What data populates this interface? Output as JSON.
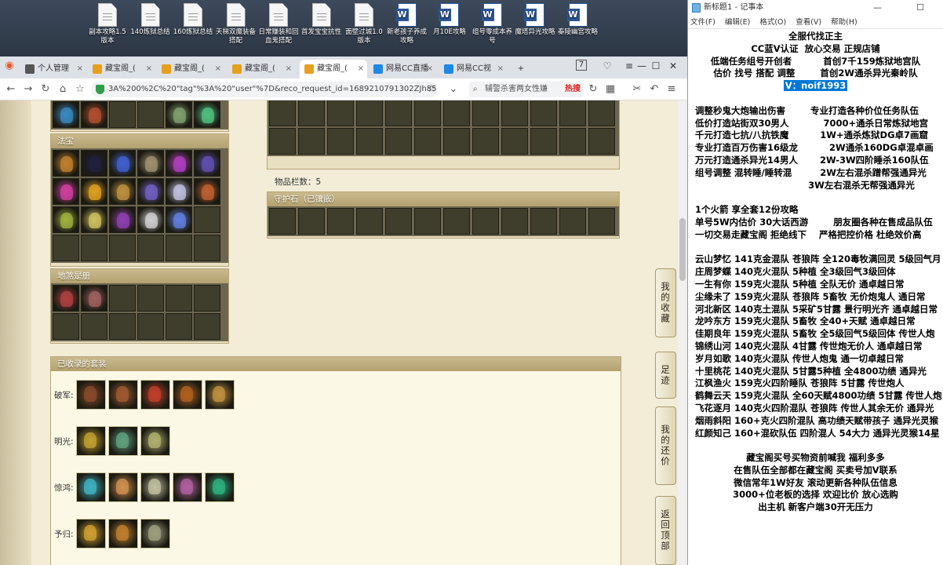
{
  "desktop": {
    "icons": [
      {
        "label": "副本攻略1.5版本",
        "type": "doc"
      },
      {
        "label": "140炼狱总结",
        "type": "doc"
      },
      {
        "label": "160炼狱总结",
        "type": "doc"
      },
      {
        "label": "天梯双魔装备搭配",
        "type": "doc"
      },
      {
        "label": "日常赚装和回血鬼搭配",
        "type": "doc"
      },
      {
        "label": "首发宝宝抗性",
        "type": "doc"
      },
      {
        "label": "面壁过城1.0版本",
        "type": "doc"
      },
      {
        "label": "新老孩子养成攻略",
        "type": "word"
      },
      {
        "label": "月10E攻略",
        "type": "word"
      },
      {
        "label": "组号零成本养号",
        "type": "word"
      },
      {
        "label": "魔塔异光攻略",
        "type": "word"
      },
      {
        "label": "秦陵幽宫攻略",
        "type": "word"
      }
    ]
  },
  "browser": {
    "tabs": [
      {
        "label": "个人管理",
        "color": "#555",
        "active": false
      },
      {
        "label": "藏宝阁_(",
        "color": "#e6a020",
        "active": false
      },
      {
        "label": "藏宝阁_(",
        "color": "#e6a020",
        "active": false
      },
      {
        "label": "藏宝阁_(",
        "color": "#e6a020",
        "active": false
      },
      {
        "label": "藏宝阁_(",
        "color": "#e6a020",
        "active": true
      },
      {
        "label": "网易CC直播",
        "color": "#1e88e5",
        "active": false
      },
      {
        "label": "网易CC视",
        "color": "#1e88e5",
        "active": false
      }
    ],
    "new_tab": "+",
    "url": "3A%200%2C%20\"tag\"%3A%20\"user\"%7D&reco_request_id=1689210791302ZJh85",
    "search_text": "辅警杀害两女性嫌",
    "search_hot": "热搜",
    "tab_count": "7"
  },
  "page": {
    "fabao_title": "法宝",
    "shenshou_title": "地煞是册",
    "item_count_label": "物品栏数：5",
    "guard_title": "守护石（已镶嵌）",
    "sets_title": "已收录的套装",
    "sets": [
      {
        "name": "破军:",
        "colors": [
          "#8a4a2a",
          "#a05a30",
          "#c0402a",
          "#b06020",
          "#c09040"
        ]
      },
      {
        "name": "明光:",
        "colors": [
          "#c0a030",
          "#60a080",
          "#b0b070"
        ]
      },
      {
        "name": "惊鸿:",
        "colors": [
          "#40b0c0",
          "#d09050",
          "#c0c0a0",
          "#b060a0",
          "#30b080"
        ]
      },
      {
        "name": "予归:",
        "colors": [
          "#d0a030",
          "#c08030",
          "#a0a080"
        ]
      }
    ],
    "side_buttons": [
      "我的收藏",
      "足迹",
      "我的还价",
      "返回顶部"
    ]
  },
  "notepad": {
    "title": "新标题1 - 记事本",
    "menu": [
      "文件(F)",
      "编辑(E)",
      "格式(O)",
      "查看(V)",
      "帮助(H)"
    ],
    "header_lines": [
      "全服代找正主",
      "CC蓝V认证  放心交易 正规店铺",
      "低端任务组号开创者          首创7千159炼狱地宫队",
      "估价 找号 搭配 调整        首创2W通杀异光秦岭队"
    ],
    "contact": "V：noif1993",
    "lines": [
      "",
      "调整秒鬼大炮输出伤害        专业打造各种价位任务队伍",
      "低价打造站街双30男人           7000+通杀日常炼狱地宫",
      "千元打造七抗/八抗铁魔          1W+通杀炼狱DG卓7画窟",
      "专业打造百万伤害16级龙          2W通杀160DG卓混卓画",
      "万元打造通杀异光14男人       2W-3W四阶睡杀160队伍",
      "组号调整 混转睡/睡转混         2W左右混杀蹭帮强通异光",
      "                                    3W左右混杀无帮强通异光",
      "",
      "1个火箭 享全套12份攻略",
      "单号5W内估价 30大话西游        朋友圈各种在售成品队伍",
      "一切交易走藏宝阁 拒绝线下    严格把控价格 杜绝效价高",
      "",
      "云山梦忆 141克金混队 苍狼阵 全120毒牧满回灵 5级回气月",
      "庄周梦蝶 140克火混队 5种植 全3级回气3级回体",
      "一生有你 159克火混队 5种植 全队无价 通卓越日常",
      "尘缘未了 159克火混队 苍狼阵 5畜牧 无价炮鬼人 通日常",
      "河北新区 140克土混队 5采矿5甘露 景行明光齐 通卓越日常",
      "龙吟东方 159克火混队 5畜牧 全40+天赋 通卓越日常",
      "佳期良年 159克火混队 5畜牧 全5级回气5级回体 传世人炮",
      "锦绣山河 140克火混队 4甘露 传世炮无价人 通卓越日常",
      "岁月如歌 140克火混队 传世人炮鬼 通一切卓越日常",
      "十里桃花 140克火混队 5甘露5种植 全4800功绩 通异光",
      "江枫渔火 159克火四阶睡队 苍狼阵 5甘露 传世炮人",
      "鹤舞云天 159克火混队 全60天赋4800功绩 5甘露 传世人炮",
      "飞花逐月 140克火四阶混队 苍狼阵 传世人其余无价 通异光",
      "烟雨斜阳 160+克火四阶混队 高功绩天赋带孩子 通异光灵猴",
      "红颜知己 160+混砍队伍 四阶混人 54大力 通异光灵猴14星",
      "",
      "藏宝阁买号买物资前喊我 福利多多",
      "在售队伍全部都在藏宝阁 买卖号加V联系",
      "微信常年1W好友 滚动更新各种队伍信息",
      "3000+位老板的选择 欢迎比价 放心选购",
      "出主机 新客户端30开无压力"
    ]
  }
}
